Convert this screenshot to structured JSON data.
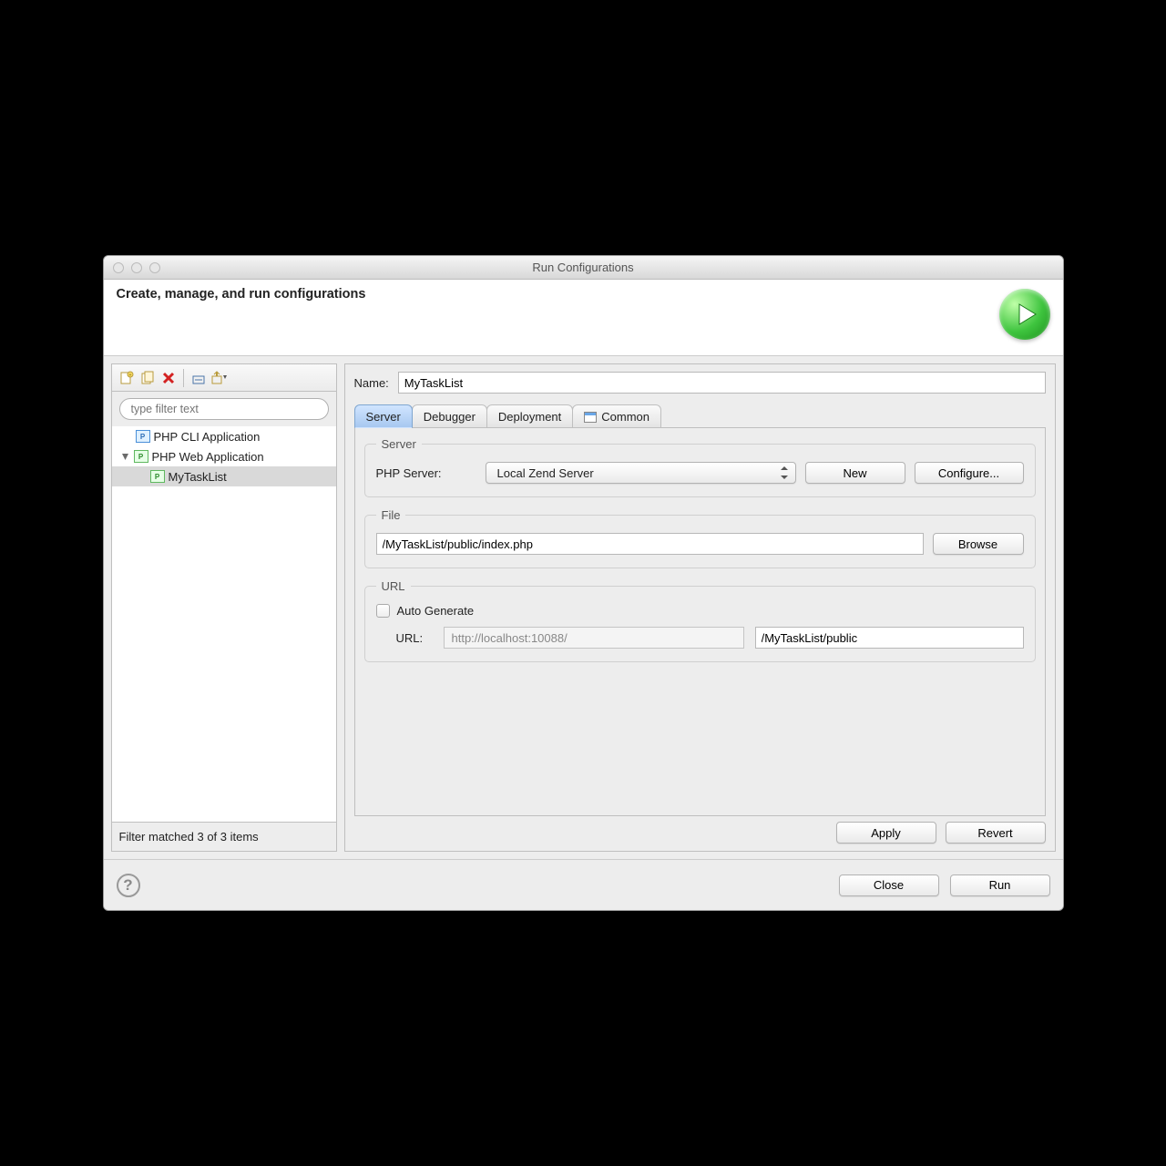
{
  "window_title": "Run Configurations",
  "header_title": "Create, manage, and run configurations",
  "filter_placeholder": "type filter text",
  "tree": {
    "items": [
      {
        "label": "PHP CLI Application",
        "icon": "P"
      },
      {
        "label": "PHP Web Application",
        "icon": "P"
      },
      {
        "label": "MyTaskList",
        "icon": "P"
      }
    ]
  },
  "filter_status": "Filter matched 3 of 3 items",
  "name_label": "Name:",
  "name_value": "MyTaskList",
  "tabs": {
    "server": "Server",
    "debugger": "Debugger",
    "deployment": "Deployment",
    "common": "Common"
  },
  "server_section": {
    "legend": "Server",
    "php_server_label": "PHP Server:",
    "php_server_value": "Local Zend Server",
    "new_btn": "New",
    "configure_btn": "Configure..."
  },
  "file_section": {
    "legend": "File",
    "path_value": "/MyTaskList/public/index.php",
    "browse_btn": "Browse"
  },
  "url_section": {
    "legend": "URL",
    "auto_generate_label": "Auto Generate",
    "url_label": "URL:",
    "url_base": "http://localhost:10088/",
    "url_path": "/MyTaskList/public"
  },
  "apply_btn": "Apply",
  "revert_btn": "Revert",
  "close_btn": "Close",
  "run_btn": "Run"
}
